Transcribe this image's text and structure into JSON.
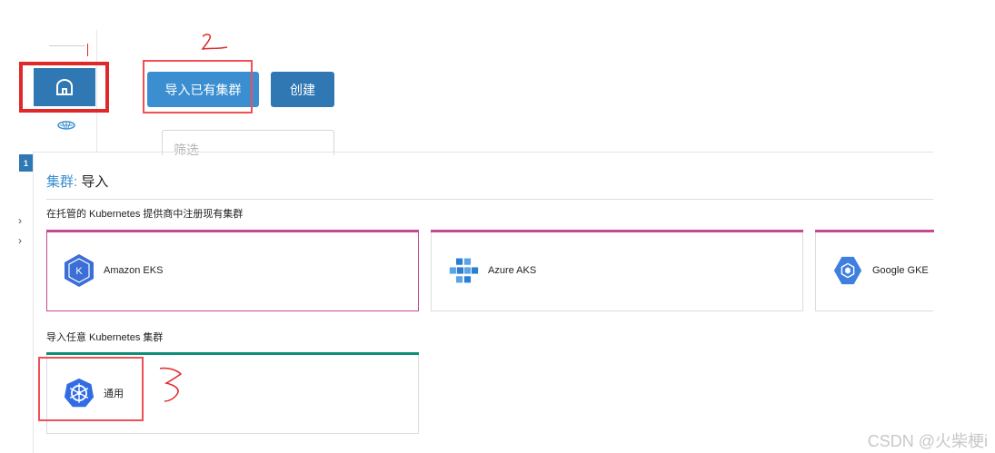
{
  "rail": {
    "home_icon": "home-icon",
    "helm_icon": "helm-wheel-icon"
  },
  "toolbar": {
    "import_label": "导入已有集群",
    "create_label": "创建"
  },
  "filter": {
    "placeholder": "筛选"
  },
  "panel": {
    "badge": "1",
    "title_prefix": "集群:",
    "title_action": "导入",
    "section_hosted": "在托管的 Kubernetes 提供商中注册现有集群",
    "section_generic": "导入任意 Kubernetes 集群",
    "expand_chevrons": [
      "›",
      "›"
    ]
  },
  "providers": [
    {
      "label": "Amazon EKS",
      "icon": "amazon-eks-icon",
      "accent": "#c4498f"
    },
    {
      "label": "Azure AKS",
      "icon": "azure-aks-icon",
      "accent": "#c4498f"
    },
    {
      "label": "Google GKE",
      "icon": "google-gke-icon",
      "accent": "#c4498f"
    }
  ],
  "generic": {
    "label": "通用",
    "icon": "kubernetes-wheel-icon",
    "accent": "#0e8f79"
  },
  "annotations": {
    "mark_2": "2",
    "mark_3": "3"
  },
  "watermark": "CSDN @火柴梗i",
  "colors": {
    "primary": "#2f78b3",
    "primary_light": "#3b8fd0",
    "annotation_red": "#e0282b"
  }
}
